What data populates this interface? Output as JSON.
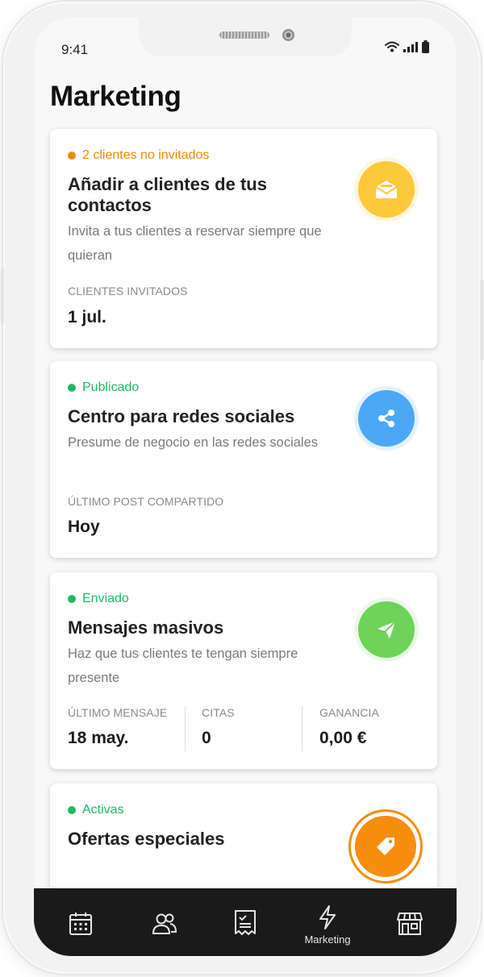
{
  "status_bar": {
    "time": "9:41"
  },
  "page": {
    "title": "Marketing"
  },
  "cards": [
    {
      "status": "2 clientes no invitados",
      "status_color": "#f08a00",
      "title": "Añadir a clientes de tus contactos",
      "description": "Invita a tus clientes a reservar siempre que quieran",
      "stat_label": "Clientes invitados",
      "stat_value": "1 jul.",
      "icon": "envelope-icon",
      "icon_color": "#fcc93a"
    },
    {
      "status": "Publicado",
      "status_color": "#1fba64",
      "title": "Centro para redes sociales",
      "description": "Presume de negocio en las redes sociales",
      "stat_label": "Último post compartido",
      "stat_value": "Hoy",
      "icon": "share-icon",
      "icon_color": "#4aa8f7"
    },
    {
      "status": "Enviado",
      "status_color": "#1fba64",
      "title": "Mensajes masivos",
      "description": "Haz que tus clientes te tengan siempre presente",
      "stats": [
        {
          "label": "Último mensaje",
          "value": "18 may."
        },
        {
          "label": "Citas",
          "value": "0"
        },
        {
          "label": "Ganancia",
          "value": "0,00 €"
        }
      ],
      "icon": "paper-plane-icon",
      "icon_color": "#6dd35a"
    },
    {
      "status": "Activas",
      "status_color": "#1fba64",
      "title": "Ofertas especiales",
      "icon": "tag-icon",
      "icon_color": "#f68d0c"
    }
  ],
  "bottom_nav": [
    {
      "icon": "calendar-icon",
      "label": ""
    },
    {
      "icon": "clients-icon",
      "label": ""
    },
    {
      "icon": "receipt-icon",
      "label": ""
    },
    {
      "icon": "lightning-icon",
      "label": "Marketing"
    },
    {
      "icon": "store-icon",
      "label": ""
    }
  ]
}
